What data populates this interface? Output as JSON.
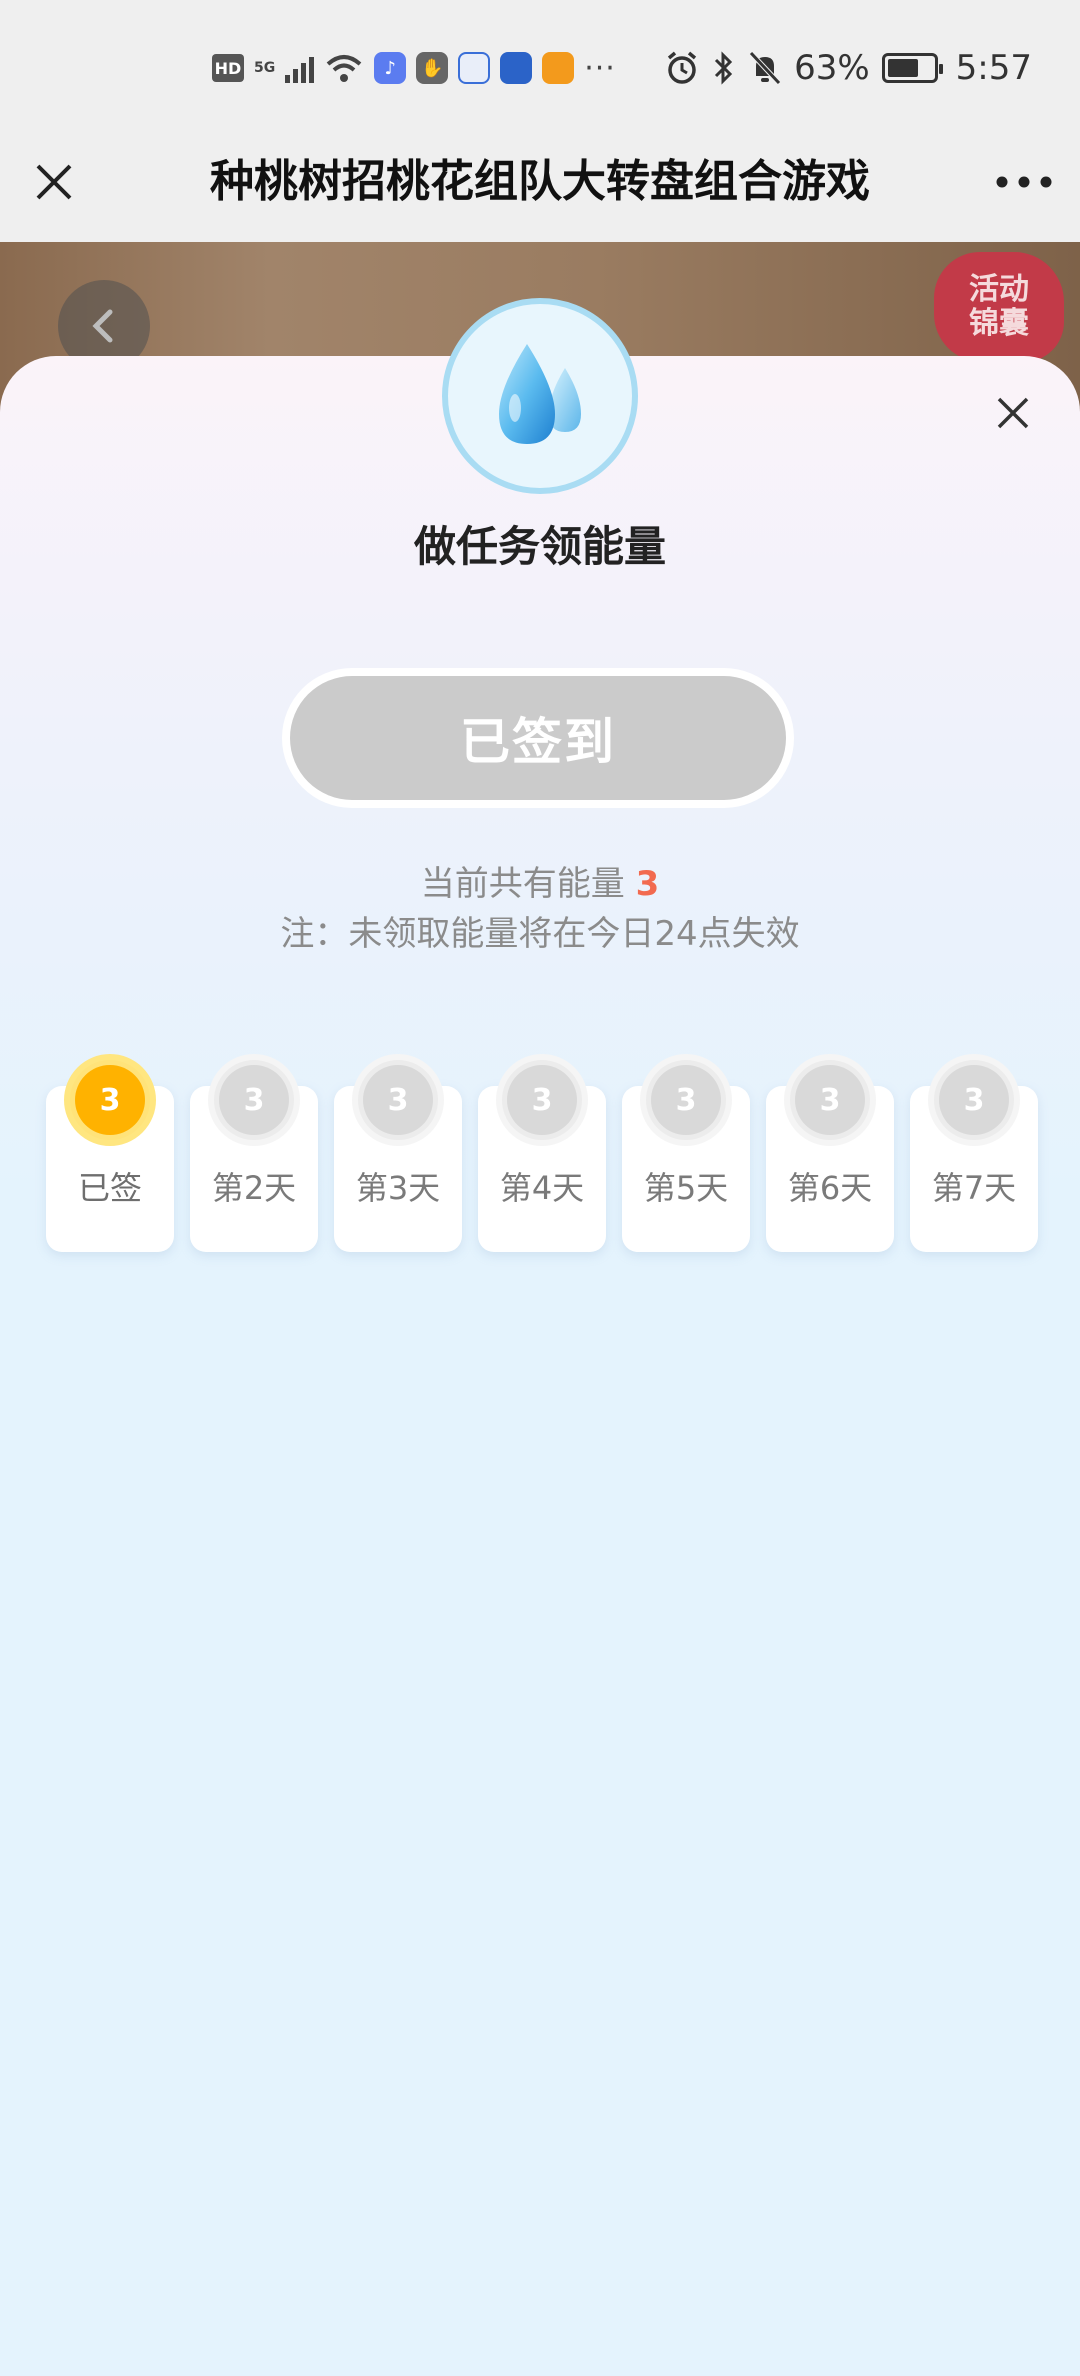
{
  "status_bar": {
    "hd": "HD",
    "network": "5G",
    "battery_percent": "63%",
    "time": "5:57",
    "battery_level": 0.63,
    "more": "···"
  },
  "nav": {
    "title": "种桃树招桃花组队大转盘组合游戏"
  },
  "game": {
    "activity_badge": "活动锦囊"
  },
  "modal": {
    "title": "做任务领能量",
    "signed_button": "已签到",
    "energy_label": "当前共有能量",
    "energy_value": "3",
    "note": "注：未领取能量将在今日24点失效"
  },
  "days": [
    {
      "value": "3",
      "label": "已签"
    },
    {
      "value": "3",
      "label": "第2天"
    },
    {
      "value": "3",
      "label": "第3天"
    },
    {
      "value": "3",
      "label": "第4天"
    },
    {
      "value": "3",
      "label": "第5天"
    },
    {
      "value": "3",
      "label": "第6天"
    },
    {
      "value": "3",
      "label": "第7天"
    }
  ],
  "colors": {
    "accent": "#ffb200",
    "energy_number": "#f26a4f",
    "disabled_button": "#cbcbcb",
    "background": "#e4f3fd"
  }
}
